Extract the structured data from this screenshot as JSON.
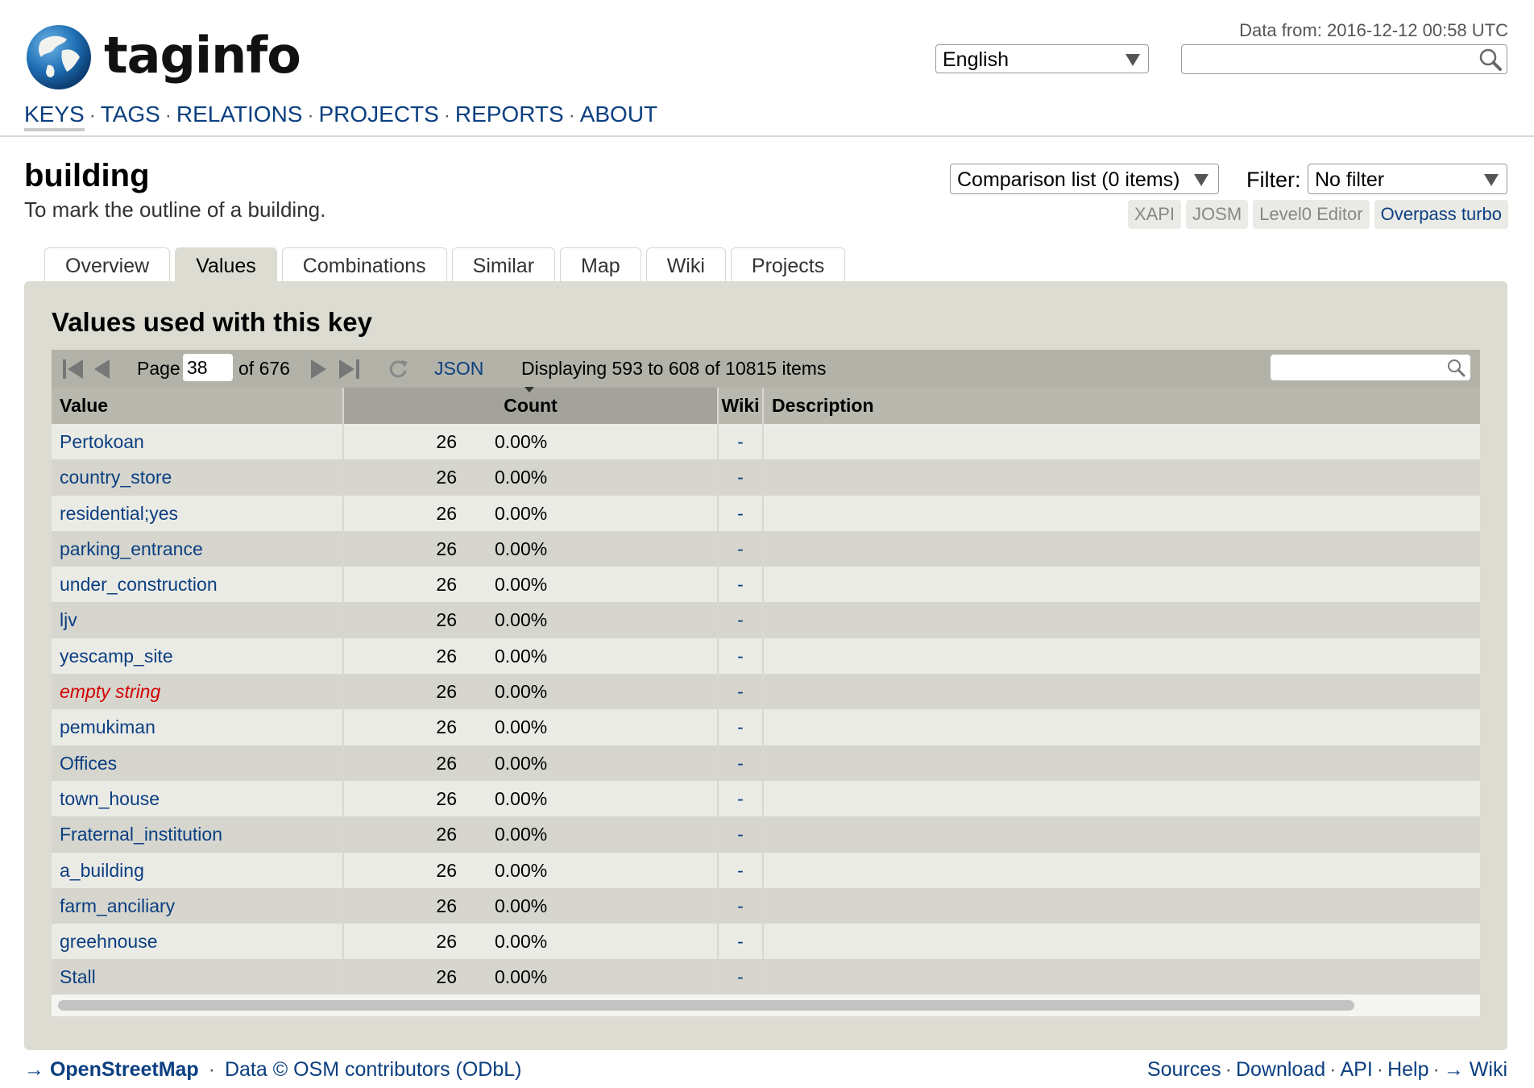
{
  "header": {
    "logo_text": "taginfo",
    "data_from": "Data from: 2016-12-12 00:58 UTC",
    "language": "English",
    "search_value": ""
  },
  "nav": {
    "items": [
      "KEYS",
      "TAGS",
      "RELATIONS",
      "PROJECTS",
      "REPORTS",
      "ABOUT"
    ],
    "active": "KEYS"
  },
  "page": {
    "title": "building",
    "description": "To mark the outline of a building.",
    "comparison": "Comparison list (0 items)",
    "filter_label": "Filter:",
    "filter_value": "No filter",
    "editors": [
      "XAPI",
      "JOSM",
      "Level0 Editor",
      "Overpass turbo"
    ]
  },
  "tabs": [
    "Overview",
    "Values",
    "Combinations",
    "Similar",
    "Map",
    "Wiki",
    "Projects"
  ],
  "active_tab": "Values",
  "panel": {
    "title": "Values used with this key"
  },
  "pager": {
    "page_label": "Page",
    "page_value": "38",
    "of_label": "of 676",
    "json_label": "JSON",
    "display": "Displaying 593 to 608 of 10815 items"
  },
  "table": {
    "columns": [
      "Value",
      "Count",
      "Wiki",
      "Description"
    ],
    "rows": [
      {
        "value": "Pertokoan",
        "count": "26",
        "pct": "0.00%",
        "wiki": "-",
        "description": "",
        "empty": false
      },
      {
        "value": "country_store",
        "count": "26",
        "pct": "0.00%",
        "wiki": "-",
        "description": "",
        "empty": false
      },
      {
        "value": "residential;yes",
        "count": "26",
        "pct": "0.00%",
        "wiki": "-",
        "description": "",
        "empty": false
      },
      {
        "value": "parking_entrance",
        "count": "26",
        "pct": "0.00%",
        "wiki": "-",
        "description": "",
        "empty": false
      },
      {
        "value": "under_construction",
        "count": "26",
        "pct": "0.00%",
        "wiki": "-",
        "description": "",
        "empty": false
      },
      {
        "value": "ljv",
        "count": "26",
        "pct": "0.00%",
        "wiki": "-",
        "description": "",
        "empty": false
      },
      {
        "value": "yescamp_site",
        "count": "26",
        "pct": "0.00%",
        "wiki": "-",
        "description": "",
        "empty": false
      },
      {
        "value": "empty string",
        "count": "26",
        "pct": "0.00%",
        "wiki": "-",
        "description": "",
        "empty": true
      },
      {
        "value": "pemukiman",
        "count": "26",
        "pct": "0.00%",
        "wiki": "-",
        "description": "",
        "empty": false
      },
      {
        "value": "Offices",
        "count": "26",
        "pct": "0.00%",
        "wiki": "-",
        "description": "",
        "empty": false
      },
      {
        "value": "town_house",
        "count": "26",
        "pct": "0.00%",
        "wiki": "-",
        "description": "",
        "empty": false
      },
      {
        "value": "Fraternal_institution",
        "count": "26",
        "pct": "0.00%",
        "wiki": "-",
        "description": "",
        "empty": false
      },
      {
        "value": "a_building",
        "count": "26",
        "pct": "0.00%",
        "wiki": "-",
        "description": "",
        "empty": false
      },
      {
        "value": "farm_anciliary",
        "count": "26",
        "pct": "0.00%",
        "wiki": "-",
        "description": "",
        "empty": false
      },
      {
        "value": "greehnouse",
        "count": "26",
        "pct": "0.00%",
        "wiki": "-",
        "description": "",
        "empty": false
      },
      {
        "value": "Stall",
        "count": "26",
        "pct": "0.00%",
        "wiki": "-",
        "description": "",
        "empty": false
      }
    ]
  },
  "footer": {
    "arrow": "→",
    "osm_link": "OpenStreetMap",
    "data_credit": "Data © OSM contributors (ODbL)",
    "links": [
      "Sources",
      "Download",
      "API",
      "Help",
      "→ Wiki"
    ]
  },
  "colors": {
    "link": "#0b3f80",
    "panel_bg": "#dcdcd3",
    "row_odd": "#ebebe6",
    "row_even": "#d6d6cf",
    "empty_string": "#d20000"
  }
}
